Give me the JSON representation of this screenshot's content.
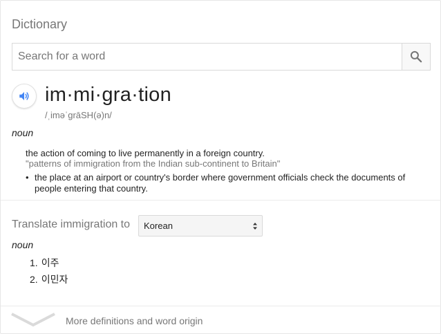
{
  "header": {
    "title": "Dictionary"
  },
  "search": {
    "placeholder": "Search for a word",
    "value": "",
    "icon": "search-icon"
  },
  "entry": {
    "speaker_icon": "speaker-icon",
    "headword": "im·mi·gra·tion",
    "phonetic": "/ˌiməˈɡrāSH(ə)n/",
    "part_of_speech": "noun",
    "definitions": [
      {
        "text": "the action of coming to live permanently in a foreign country.",
        "example": "\"patterns of immigration from the Indian sub-continent to Britain\""
      },
      {
        "bullet": "•",
        "text": "the place at an airport or country's border where government officials check the documents of people entering that country."
      }
    ]
  },
  "translate": {
    "label": "Translate immigration to",
    "selected_language": "Korean",
    "part_of_speech": "noun",
    "items": [
      {
        "num": "1.",
        "text": "이주"
      },
      {
        "num": "2.",
        "text": "이민자"
      }
    ]
  },
  "footer": {
    "more_label": "More definitions and word origin",
    "chevron_icon": "chevron-down-icon"
  },
  "colors": {
    "accent": "#4285f4",
    "muted_text": "#777777",
    "text": "#222222",
    "border": "#d9d9d9"
  }
}
